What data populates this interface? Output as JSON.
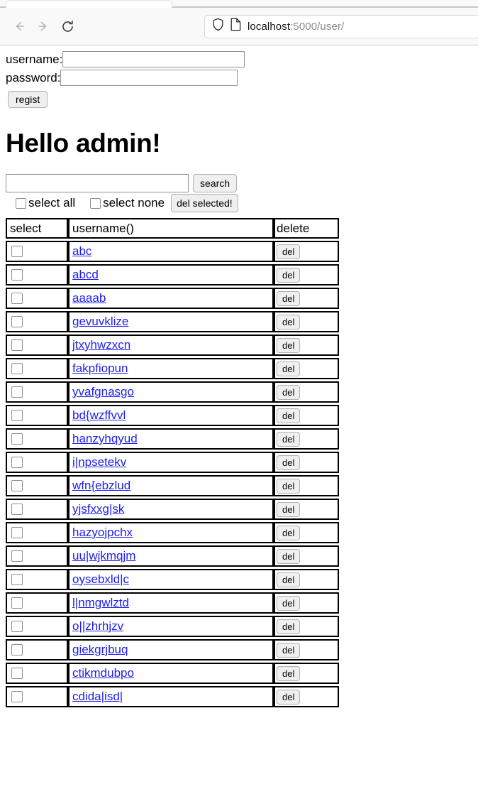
{
  "browser": {
    "back_icon": "back-arrow-icon",
    "forward_icon": "forward-arrow-icon",
    "reload_icon": "reload-icon",
    "shield_icon": "shield-icon",
    "page_icon": "page-document-icon",
    "url_host": "localhost",
    "url_path": ":5000/user/"
  },
  "form": {
    "username_label": "username:",
    "password_label": "password:",
    "username_value": "",
    "password_value": "",
    "regist_label": "regist"
  },
  "greeting": "Hello admin!",
  "search": {
    "value": "",
    "button_label": "search"
  },
  "bulk": {
    "select_all_label": "select all",
    "select_none_label": "select none",
    "del_selected_label": "del selected!"
  },
  "table": {
    "columns": [
      "select",
      "username()",
      "delete"
    ],
    "del_label": "del",
    "rows": [
      {
        "username": "abc"
      },
      {
        "username": "abcd"
      },
      {
        "username": "aaaab"
      },
      {
        "username": "gevuvklize"
      },
      {
        "username": "jtxyhwzxcn"
      },
      {
        "username": "fakpfiopun"
      },
      {
        "username": "yvafgnasgo"
      },
      {
        "username": "bd{wzffvvl"
      },
      {
        "username": "hanzyhqyud"
      },
      {
        "username": "i|npsetekv"
      },
      {
        "username": "wfn{ebzlud"
      },
      {
        "username": "yjsfxxg|sk"
      },
      {
        "username": "hazyojpchx"
      },
      {
        "username": "uu|wjkmqjm"
      },
      {
        "username": "oysebxld|c"
      },
      {
        "username": "l|nmgwlztd"
      },
      {
        "username": "o||zhrhjzv"
      },
      {
        "username": "giekgrjbuq"
      },
      {
        "username": "ctikmdubpo"
      },
      {
        "username": "cdida|isd|"
      }
    ]
  },
  "colors": {
    "link": "#2020ee",
    "chrome_bg": "#f9f9fa",
    "url_text": "#8a8a8f"
  }
}
